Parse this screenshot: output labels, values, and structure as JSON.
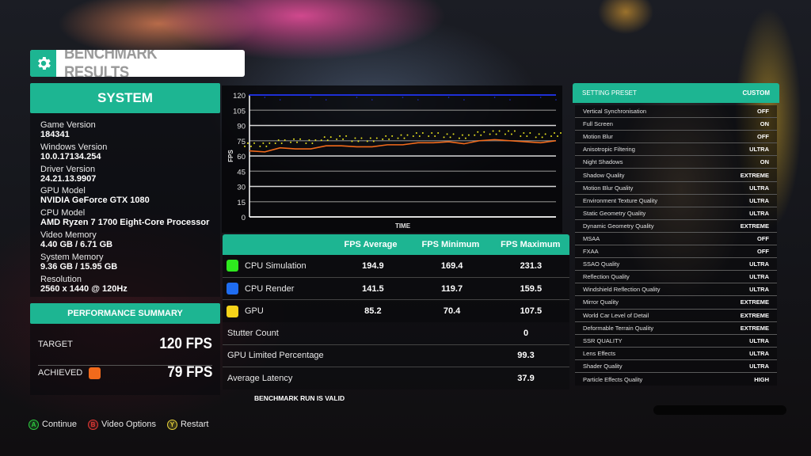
{
  "header": {
    "title": "BENCHMARK RESULTS",
    "icon": "gear-icon"
  },
  "system": {
    "title": "SYSTEM",
    "items": [
      {
        "label": "Game Version",
        "value": "184341"
      },
      {
        "label": "Windows Version",
        "value": "10.0.17134.254"
      },
      {
        "label": "Driver Version",
        "value": "24.21.13.9907"
      },
      {
        "label": "GPU Model",
        "value": "NVIDIA GeForce GTX 1080"
      },
      {
        "label": "CPU Model",
        "value": "AMD Ryzen 7 1700 Eight-Core Processor"
      },
      {
        "label": "Video Memory",
        "value": "4.40 GB / 6.71 GB"
      },
      {
        "label": "System Memory",
        "value": "9.36 GB / 15.95 GB"
      },
      {
        "label": "Resolution",
        "value": "2560 x 1440 @ 120Hz"
      }
    ]
  },
  "performance_summary": {
    "title": "PERFORMANCE SUMMARY",
    "target_label": "TARGET",
    "target_value": "120 FPS",
    "achieved_label": "ACHIEVED",
    "achieved_value": "79 FPS",
    "achieved_color": "#f26a1b"
  },
  "controls": [
    {
      "glyph": "A",
      "label": "Continue",
      "color": "#2ecc40"
    },
    {
      "glyph": "B",
      "label": "Video Options",
      "color": "#e53935"
    },
    {
      "glyph": "Y",
      "label": "Restart",
      "color": "#e8d23a"
    }
  ],
  "chart_data": {
    "type": "line",
    "title": "",
    "xlabel": "TIME",
    "ylabel": "FPS",
    "ylim": [
      0,
      120
    ],
    "yticks": [
      0,
      15,
      30,
      45,
      60,
      75,
      90,
      105,
      120
    ],
    "grid": true,
    "x": [
      0,
      5,
      10,
      15,
      20,
      25,
      30,
      35,
      40,
      45,
      50,
      55,
      60,
      65,
      70,
      75,
      80,
      85,
      90,
      95,
      100
    ],
    "series": [
      {
        "name": "CPU Render",
        "color": "#1e2fd6",
        "style": "scatter-line",
        "values": [
          120,
          120,
          120,
          120,
          120,
          120,
          120,
          120,
          120,
          120,
          120,
          120,
          120,
          120,
          120,
          120,
          120,
          120,
          120,
          120,
          120
        ]
      },
      {
        "name": "GPU",
        "color": "#e8e21e",
        "style": "scatter",
        "values": [
          71,
          71,
          74,
          75,
          74,
          77,
          78,
          76,
          76,
          78,
          79,
          81,
          81,
          80,
          79,
          82,
          83,
          83,
          81,
          80,
          81
        ]
      },
      {
        "name": "Achieved",
        "color": "#f26a1b",
        "style": "line",
        "values": [
          65,
          64,
          68,
          67,
          67,
          70,
          70,
          69,
          69,
          71,
          71,
          73,
          73,
          74,
          72,
          75,
          76,
          75,
          74,
          73,
          75
        ]
      }
    ]
  },
  "results_table": {
    "columns": [
      "FPS Average",
      "FPS Minimum",
      "FPS Maximum"
    ],
    "rows": [
      {
        "name": "CPU Simulation",
        "color": "#2ee81e",
        "avg": "194.9",
        "min": "169.4",
        "max": "231.3"
      },
      {
        "name": "CPU Render",
        "color": "#1f6cf0",
        "avg": "141.5",
        "min": "119.7",
        "max": "159.5"
      },
      {
        "name": "GPU",
        "color": "#f5d21a",
        "avg": "85.2",
        "min": "70.4",
        "max": "107.5"
      }
    ]
  },
  "stats": [
    {
      "label": "Stutter Count",
      "value": "0"
    },
    {
      "label": "GPU Limited Percentage",
      "value": "99.3"
    },
    {
      "label": "Average Latency",
      "value": "37.9"
    }
  ],
  "validity": "BENCHMARK RUN IS VALID",
  "settings": {
    "preset_label": "SETTING PRESET",
    "preset_value": "CUSTOM",
    "items": [
      {
        "name": "Vertical Synchronisation",
        "value": "OFF"
      },
      {
        "name": "Full Screen",
        "value": "ON"
      },
      {
        "name": "Motion Blur",
        "value": "OFF"
      },
      {
        "name": "Anisotropic Filtering",
        "value": "ULTRA"
      },
      {
        "name": "Night Shadows",
        "value": "ON"
      },
      {
        "name": "Shadow Quality",
        "value": "EXTREME"
      },
      {
        "name": "Motion Blur Quality",
        "value": "ULTRA"
      },
      {
        "name": "Environment Texture Quality",
        "value": "ULTRA"
      },
      {
        "name": "Static Geometry Quality",
        "value": "ULTRA"
      },
      {
        "name": "Dynamic Geometry Quality",
        "value": "EXTREME"
      },
      {
        "name": "MSAA",
        "value": "OFF"
      },
      {
        "name": "FXAA",
        "value": "OFF"
      },
      {
        "name": "SSAO Quality",
        "value": "ULTRA"
      },
      {
        "name": "Reflection Quality",
        "value": "ULTRA"
      },
      {
        "name": "Windshield Reflection Quality",
        "value": "ULTRA"
      },
      {
        "name": "Mirror Quality",
        "value": "EXTREME"
      },
      {
        "name": "World Car Level of Detail",
        "value": "EXTREME"
      },
      {
        "name": "Deformable Terrain Quality",
        "value": "EXTREME"
      },
      {
        "name": "SSR QUALITY",
        "value": "ULTRA"
      },
      {
        "name": "Lens Effects",
        "value": "ULTRA"
      },
      {
        "name": "Shader Quality",
        "value": "ULTRA"
      },
      {
        "name": "Particle Effects Quality",
        "value": "HIGH"
      }
    ]
  },
  "colors": {
    "accent": "#1db592",
    "header_text": "#ffffff"
  }
}
